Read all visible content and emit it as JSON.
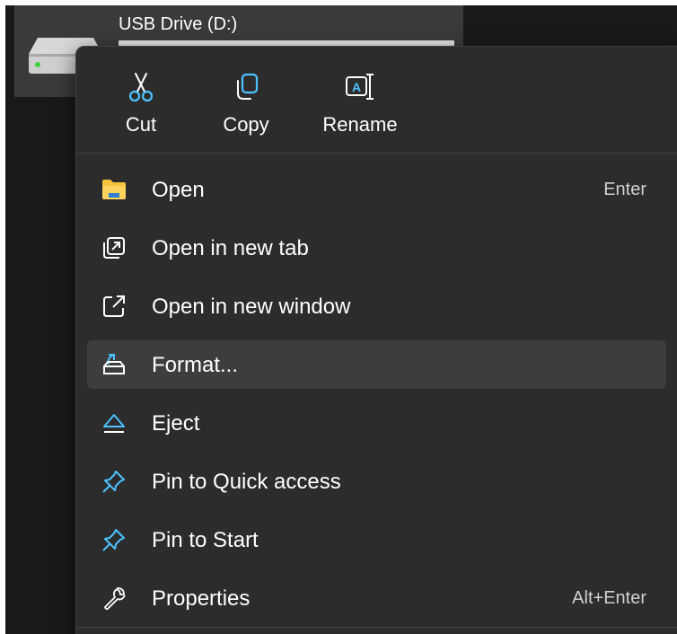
{
  "drive": {
    "name": "USB Drive (D:)",
    "icon": "usb-drive-icon"
  },
  "quick_actions": [
    {
      "label": "Cut",
      "icon": "scissors-icon"
    },
    {
      "label": "Copy",
      "icon": "copy-icon"
    },
    {
      "label": "Rename",
      "icon": "rename-icon"
    }
  ],
  "menu": {
    "items": [
      {
        "label": "Open",
        "icon": "folder-icon",
        "shortcut": "Enter"
      },
      {
        "label": "Open in new tab",
        "icon": "new-tab-icon",
        "shortcut": ""
      },
      {
        "label": "Open in new window",
        "icon": "new-window-icon",
        "shortcut": ""
      },
      {
        "label": "Format...",
        "icon": "format-icon",
        "shortcut": "",
        "highlighted": true
      },
      {
        "label": "Eject",
        "icon": "eject-icon",
        "shortcut": ""
      },
      {
        "label": "Pin to Quick access",
        "icon": "pin-icon",
        "shortcut": ""
      },
      {
        "label": "Pin to Start",
        "icon": "pin-icon",
        "shortcut": ""
      },
      {
        "label": "Properties",
        "icon": "wrench-icon",
        "shortcut": "Alt+Enter"
      }
    ]
  },
  "colors": {
    "background": "#191919",
    "menu_bg": "#2c2c2c",
    "hover_bg": "#3d3d3d",
    "accent_blue": "#4cc2ff",
    "folder_yellow": "#f8c33c"
  }
}
